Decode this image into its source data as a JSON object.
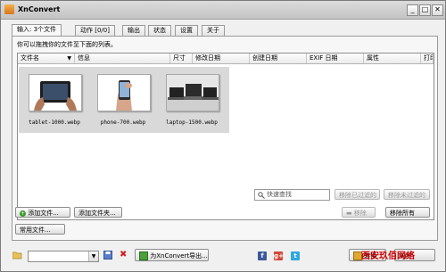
{
  "window": {
    "title": "XnConvert",
    "minimize": "_",
    "maximize": "□",
    "close": "✕"
  },
  "tabs": [
    {
      "label": "输入: 3个文件"
    },
    {
      "label": "动作 [0/0]"
    },
    {
      "label": "输出"
    },
    {
      "label": "状态"
    },
    {
      "label": "设置"
    },
    {
      "label": "关于"
    }
  ],
  "input_panel": {
    "hint": "你可以拖拽你的文件至下面的列表。",
    "columns": [
      "文件名",
      "信息",
      "尺寸",
      "修改日期",
      "创建日期",
      "EXIF 日期",
      "属性",
      "打印"
    ],
    "files": [
      {
        "name": "tablet-1000.webp"
      },
      {
        "name": "phone-700.webp"
      },
      {
        "name": "laptop-1500.webp"
      }
    ],
    "search_placeholder": "快速查找",
    "remove_filtered": "移除已过滤的",
    "remove_unfiltered": "移除未过滤的",
    "remove": "移除",
    "remove_all": "移除所有",
    "add_files": "添加文件...",
    "add_folder": "添加文件夹...",
    "common_folders": "常用文件..."
  },
  "bottom": {
    "export_button": "为XnConvert导出...",
    "convert_button": "转换",
    "close_button": "关闭",
    "watermark": "西安玖佰网络"
  },
  "icons": {
    "app": "xnconvert-app-icon",
    "open_folder": "folder-open-icon",
    "save": "save-icon",
    "delete": "delete-x-icon",
    "facebook": "facebook-icon",
    "googleplus": "google-plus-icon",
    "twitter": "twitter-icon"
  }
}
